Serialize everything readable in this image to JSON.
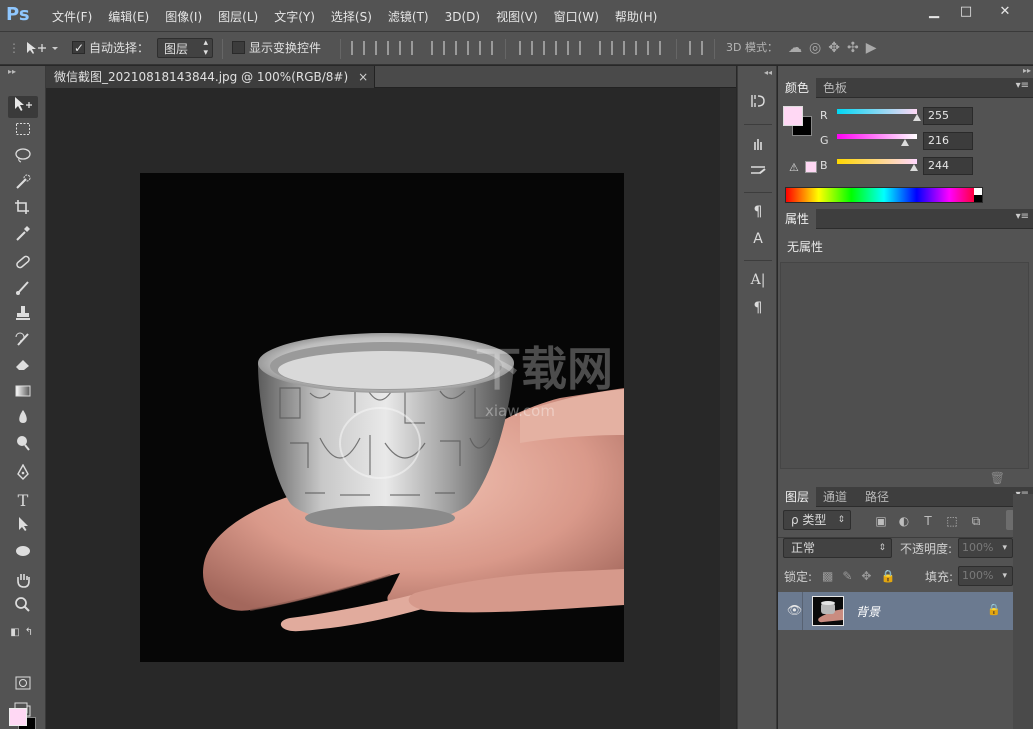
{
  "app": {
    "logo": "Ps",
    "menus": [
      "文件(F)",
      "编辑(E)",
      "图像(I)",
      "图层(L)",
      "文字(Y)",
      "选择(S)",
      "滤镜(T)",
      "3D(D)",
      "视图(V)",
      "窗口(W)",
      "帮助(H)"
    ],
    "window_controls": {
      "minimize": "▁",
      "restore": "□",
      "close": "✕"
    }
  },
  "options": {
    "auto_select_label": "自动选择：",
    "auto_select_checked": true,
    "layer_select_value": "图层",
    "show_transform_label": "显示变换控件",
    "show_transform_checked": false,
    "mode_3d_label": "3D 模式："
  },
  "document": {
    "tab_title": "微信截图_20210818143844.jpg @ 100%(RGB/8#)",
    "close_glyph": "×",
    "watermark_main": "下载网",
    "watermark_sub": "xiaw.com"
  },
  "color_panel": {
    "tabs": [
      "颜色",
      "色板"
    ],
    "active_tab": "颜色",
    "foreground": "#ffd8f4",
    "background": "#000000",
    "channels": [
      {
        "name": "R",
        "value": "255",
        "fraction": 1.0,
        "gradient": [
          "#00d8f4",
          "#ffd8f4"
        ]
      },
      {
        "name": "G",
        "value": "216",
        "fraction": 0.847,
        "gradient": [
          "#ff00f4",
          "#ffffff"
        ]
      },
      {
        "name": "B",
        "value": "244",
        "fraction": 0.957,
        "gradient": [
          "#ffd800",
          "#ffd8ff"
        ]
      }
    ]
  },
  "properties_panel": {
    "tab": "属性",
    "content": "无属性"
  },
  "layers_panel": {
    "tabs": [
      "图层",
      "通道",
      "路径"
    ],
    "active_tab": "图层",
    "filter_label": "ρ 类型",
    "blend_mode": "正常",
    "opacity_label": "不透明度:",
    "opacity_value": "100%",
    "lock_label": "锁定:",
    "fill_label": "填充:",
    "fill_value": "100%",
    "layers": [
      {
        "name": "背景",
        "visible": true,
        "locked": true
      }
    ]
  }
}
